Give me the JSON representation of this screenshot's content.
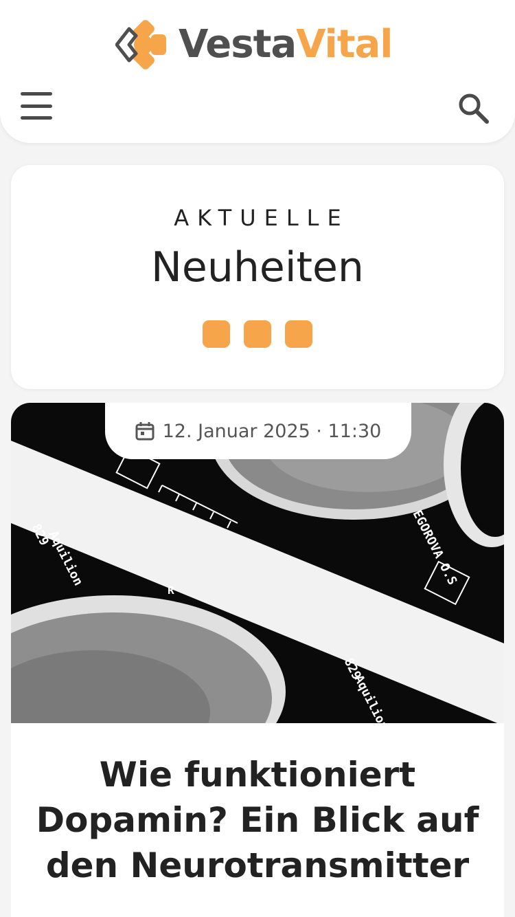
{
  "brand": {
    "part1": "Vesta",
    "part2": "Vital",
    "accent": "#f6a54a",
    "dark": "#4f4f4f"
  },
  "header": {
    "menu_icon": "hamburger-icon",
    "search_icon": "search-icon"
  },
  "news": {
    "kicker": "AKTUELLE",
    "title": "Neuheiten"
  },
  "article": {
    "date": "12. Januar 2025 · 11:30",
    "title": "Wie funktioniert Dopamin? Ein Blick auf den Neurotransmitter",
    "image_texts": {
      "label_a": "EGOROVA O.S",
      "label_b": "829",
      "label_c": "Aquilion",
      "label_d": "R"
    }
  }
}
